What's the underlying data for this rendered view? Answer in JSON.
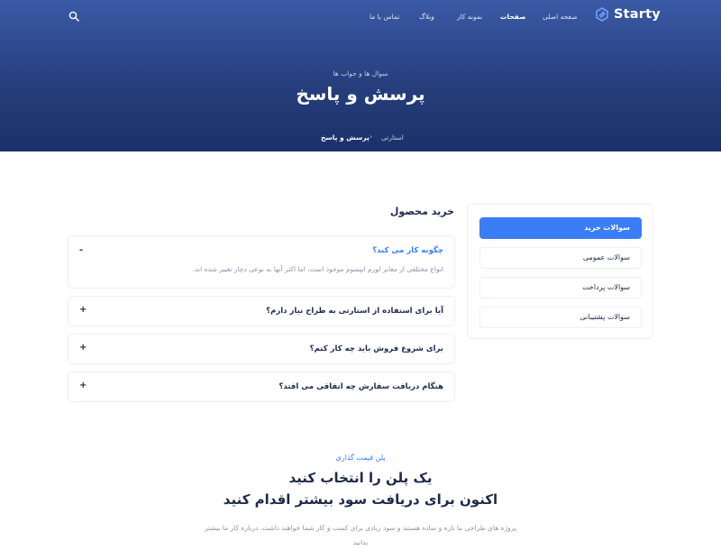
{
  "header": {
    "logo_text": "Starty",
    "nav": [
      {
        "label": "صفحه اصلی",
        "active": false
      },
      {
        "label": "صفحات",
        "active": true
      },
      {
        "label": "نمونه کار",
        "active": false
      },
      {
        "label": "وبلاگ",
        "active": false
      },
      {
        "label": "تماس با ما",
        "active": false
      }
    ],
    "search_icon": "search-icon"
  },
  "hero": {
    "subtitle": "سوال ها و جواب ها",
    "title": "پرسش و پاسخ",
    "breadcrumb": {
      "home": "استارتی",
      "separator": "›",
      "current": "پرسش و پاسخ"
    }
  },
  "sidebar": {
    "items": [
      {
        "label": "سوالات خرید",
        "active": true
      },
      {
        "label": "سوالات عمومی",
        "active": false
      },
      {
        "label": "سوالات پرداخت",
        "active": false
      },
      {
        "label": "سوالات پشتیبانی",
        "active": false
      }
    ]
  },
  "faq": {
    "section_title": "خرید محصول",
    "items": [
      {
        "question": "چگونه کار می کند؟",
        "answer": "انواع مختلفی از معابر لورم ایپسوم موجود است، اما اکثر آنها به نوعی دچار تغییر شده اند.",
        "open": true,
        "toggle": "-"
      },
      {
        "question": "آیا برای استفاده از استارتی به طراح نیاز دارم؟",
        "open": false,
        "toggle": "+"
      },
      {
        "question": "برای شروع فروش باید چه کار کنم؟",
        "open": false,
        "toggle": "+"
      },
      {
        "question": "هنگام دریافت سفارش چه اتفاقی می افتد؟",
        "open": false,
        "toggle": "+"
      }
    ]
  },
  "pricing": {
    "kicker": "پلن قیمت گذاری",
    "heading_line1": "یک پلن را انتخاب کنید",
    "heading_line2": "اکنون برای دریافت سود بیشتر اقدام کنید",
    "description": "پروژه های طراحی ما تازه و ساده هستند و سود زیادی برای کسب و کار شما خواهند داشت. درباره کار ما بیشتر بدانید"
  },
  "colors": {
    "accent": "#3b7cf7",
    "hero_top": "#3b5aa6",
    "hero_bottom": "#1c3068",
    "text_dark": "#1e2a4a",
    "text_muted": "#8a93a8"
  }
}
